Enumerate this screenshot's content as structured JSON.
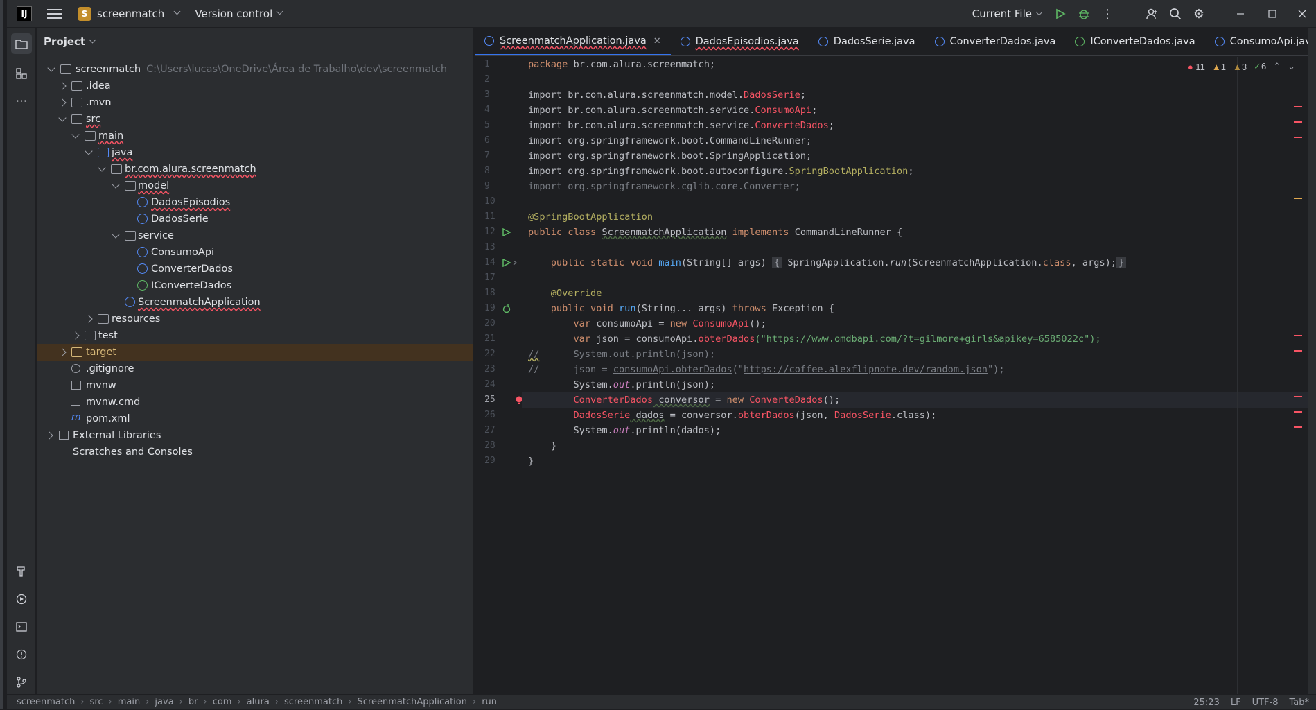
{
  "titlebar": {
    "logo": "IJ",
    "project_initial": "S",
    "project_name": "screenmatch",
    "version_control": "Version control",
    "run_config": "Current File"
  },
  "panel": {
    "title": "Project",
    "tree": [
      {
        "label": "screenmatch",
        "path": "C:\\Users\\lucas\\OneDrive\\Área de Trabalho\\dev\\screenmatch"
      },
      {
        "label": ".idea"
      },
      {
        "label": ".mvn"
      },
      {
        "label": "src"
      },
      {
        "label": "main"
      },
      {
        "label": "java"
      },
      {
        "label": "br.com.alura.screenmatch"
      },
      {
        "label": "model"
      },
      {
        "label": "DadosEpisodios"
      },
      {
        "label": "DadosSerie"
      },
      {
        "label": "service"
      },
      {
        "label": "ConsumoApi"
      },
      {
        "label": "ConverterDados"
      },
      {
        "label": "IConverteDados"
      },
      {
        "label": "ScreenmatchApplication"
      },
      {
        "label": "resources"
      },
      {
        "label": "test"
      },
      {
        "label": "target"
      },
      {
        "label": ".gitignore"
      },
      {
        "label": "mvnw"
      },
      {
        "label": "mvnw.cmd"
      },
      {
        "label": "pom.xml"
      },
      {
        "label": "External Libraries"
      },
      {
        "label": "Scratches and Consoles"
      }
    ]
  },
  "tabs": [
    {
      "label": "ScreenmatchApplication.java"
    },
    {
      "label": "DadosEpisodios.java"
    },
    {
      "label": "DadosSerie.java"
    },
    {
      "label": "ConverterDados.java"
    },
    {
      "label": "IConverteDados.java"
    },
    {
      "label": "ConsumoApi.java"
    }
  ],
  "inspections": {
    "errors": "11",
    "warnings": "1",
    "weak": "3",
    "ok": "6"
  },
  "line_numbers": [
    "1",
    "2",
    "3",
    "4",
    "5",
    "6",
    "7",
    "8",
    "9",
    "10",
    "11",
    "12",
    "13",
    "14",
    "17",
    "18",
    "19",
    "20",
    "21",
    "22",
    "23",
    "24",
    "25",
    "26",
    "27",
    "28",
    "29"
  ],
  "code": {
    "l1": "package br.com.alura.screenmatch;",
    "l3a": "import br.com.alura.screenmatch.model.",
    "l3b": "DadosSerie",
    "l4a": "import br.com.alura.screenmatch.service.",
    "l4b": "ConsumoApi",
    "l5a": "import br.com.alura.screenmatch.service.",
    "l5b": "ConverteDados",
    "l6": "import org.springframework.boot.CommandLineRunner;",
    "l7": "import org.springframework.boot.SpringApplication;",
    "l8a": "import org.springframework.boot.autoconfigure.",
    "l8b": "SpringBootApplication",
    "l9": "import org.springframework.cglib.core.Converter;",
    "l11": "@SpringBootApplication",
    "l12a": "public class ",
    "l12b": "ScreenmatchApplication",
    "l12c": " implements ",
    "l12d": "CommandLineRunner {",
    "l14a": "    public static void ",
    "l14b": "main",
    "l14c": "(String[] args) ",
    "l14d": "{",
    "l14e": " SpringApplication.",
    "l14f": "run",
    "l14g": "(ScreenmatchApplication.",
    "l14h": "class",
    "l14i": ", args);",
    "l14j": "}",
    "l18": "    @Override",
    "l19a": "    public void ",
    "l19b": "run",
    "l19c": "(String... args) ",
    "l19d": "throws",
    "l19e": " Exception {",
    "l20a": "        var",
    "l20b": " consumoApi = ",
    "l20c": "new ",
    "l20d": "ConsumoApi",
    "l20e": "();",
    "l21a": "        var",
    "l21b": " json = consumoApi.",
    "l21c": "obterDados",
    "l21d": "(\"",
    "l21e": "https://www.omdbapi.com/?t=gilmore+girls&apikey=6585022c",
    "l21f": "\");",
    "l22a": "//",
    "l22b": "      System.out.println(json);",
    "l23a": "//",
    "l23b": "      json = ",
    "l23c": "consumoApi.obterDados",
    "l23d": "(\"",
    "l23e": "https://coffee.alexflipnote.dev/random.json",
    "l23f": "\");",
    "l24a": "        System.",
    "l24b": "out",
    "l24c": ".println(json);",
    "l25a": "        ConverterDados",
    "l25b": " conversor",
    "l25c": " = ",
    "l25d": "new ",
    "l25e": "ConverteDados",
    "l25f": "();",
    "l26a": "        DadosSerie",
    "l26b": " dados",
    "l26c": " = conversor.",
    "l26d": "obterDados",
    "l26e": "(json, ",
    "l26f": "DadosSerie",
    "l26g": ".class);",
    "l27a": "        System.",
    "l27b": "out",
    "l27c": ".println(dados);",
    "l28": "    }",
    "l29": "}"
  },
  "status": {
    "crumbs": [
      "screenmatch",
      "src",
      "main",
      "java",
      "br",
      "com",
      "alura",
      "screenmatch",
      "ScreenmatchApplication",
      "run"
    ],
    "position": "25:23",
    "line_sep": "LF",
    "encoding": "UTF-8",
    "indent": "Tab*"
  }
}
